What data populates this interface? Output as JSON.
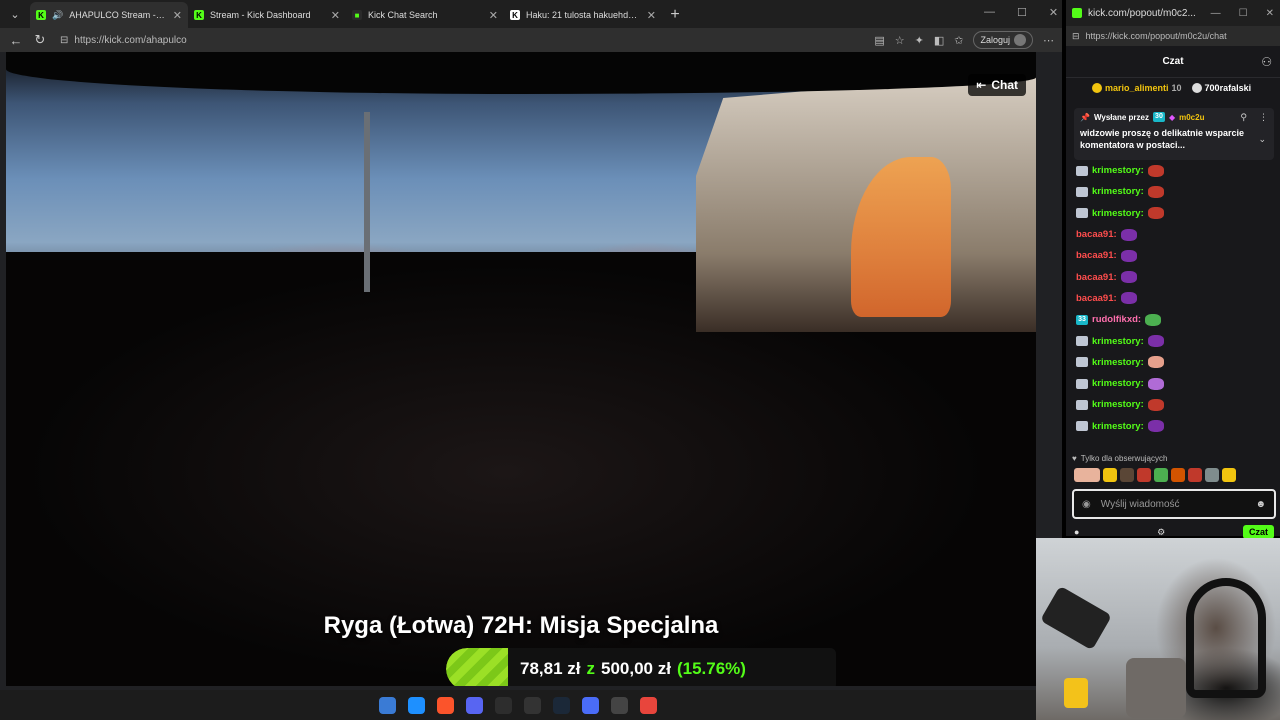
{
  "browser": {
    "tabs": [
      {
        "title": "AHAPULCO Stream - Watch Li",
        "favicon_color": "#53fc18"
      },
      {
        "title": "Stream - Kick Dashboard",
        "favicon_color": "#53fc18"
      },
      {
        "title": "Kick Chat Search",
        "favicon_color": "#2a2a2a"
      },
      {
        "title": "Haku: 21 tulosta hakuehdolla \"lipp",
        "favicon_color": "#ffffff"
      }
    ],
    "url": "https://kick.com/ahapulco",
    "login_label": "Zaloguj"
  },
  "video": {
    "chat_toggle_label": "Chat",
    "stream_title": "Ryga (Łotwa) 72H: Misja Specjalna",
    "goal": {
      "current": "78,81 zł",
      "connector": "z",
      "target": "500,00 zł",
      "percent_text": "(15.76%)",
      "fraction": 0.1576
    }
  },
  "chat_window": {
    "title": "kick.com/popout/m0c2...",
    "url": "https://kick.com/popout/m0c2u/chat",
    "header": "Czat",
    "top_gifters": [
      {
        "name": "mario_alimenti",
        "count": "10"
      },
      {
        "name": "700rafalski",
        "count": ""
      }
    ],
    "pinned": {
      "sent_by_label": "Wysłane przez",
      "author": "m0c2u",
      "message": "widzowie proszę o delikatnie wsparcie komentatora w postaci..."
    },
    "messages": [
      {
        "user": "krimestory:",
        "color": "#53fc18",
        "badge": "mod",
        "emote": "#c0392b"
      },
      {
        "user": "krimestory:",
        "color": "#53fc18",
        "badge": "mod",
        "emote": "#c0392b"
      },
      {
        "user": "krimestory:",
        "color": "#53fc18",
        "badge": "mod",
        "emote": "#c0392b"
      },
      {
        "user": "bacaa91:",
        "color": "#ff4d4d",
        "badge": "",
        "emote": "#7b2fa8"
      },
      {
        "user": "bacaa91:",
        "color": "#ff4d4d",
        "badge": "",
        "emote": "#7b2fa8"
      },
      {
        "user": "bacaa91:",
        "color": "#ff4d4d",
        "badge": "",
        "emote": "#7b2fa8"
      },
      {
        "user": "bacaa91:",
        "color": "#ff4d4d",
        "badge": "",
        "emote": "#7b2fa8"
      },
      {
        "user": "rudolfikxd:",
        "color": "#ff6fae",
        "badge": "33",
        "emote": "#4caf50"
      },
      {
        "user": "krimestory:",
        "color": "#53fc18",
        "badge": "mod",
        "emote": "#7b2fa8"
      },
      {
        "user": "krimestory:",
        "color": "#53fc18",
        "badge": "mod",
        "emote": "#e6a08c"
      },
      {
        "user": "krimestory:",
        "color": "#53fc18",
        "badge": "mod",
        "emote": "#b06bd6"
      },
      {
        "user": "krimestory:",
        "color": "#53fc18",
        "badge": "mod",
        "emote": "#c0392b"
      },
      {
        "user": "krimestory:",
        "color": "#53fc18",
        "badge": "mod",
        "emote": "#7b2fa8"
      }
    ],
    "followers_only": "Tylko dla obserwujących",
    "input_placeholder": "Wyślij wiadomość",
    "send_label": "Czat"
  },
  "taskbar": {
    "icons": [
      "windows-icon",
      "edge-icon",
      "brave-icon",
      "discord-icon",
      "app-icon",
      "epic-icon",
      "steam-icon",
      "app2-icon",
      "obs-icon",
      "chrome-icon"
    ]
  }
}
